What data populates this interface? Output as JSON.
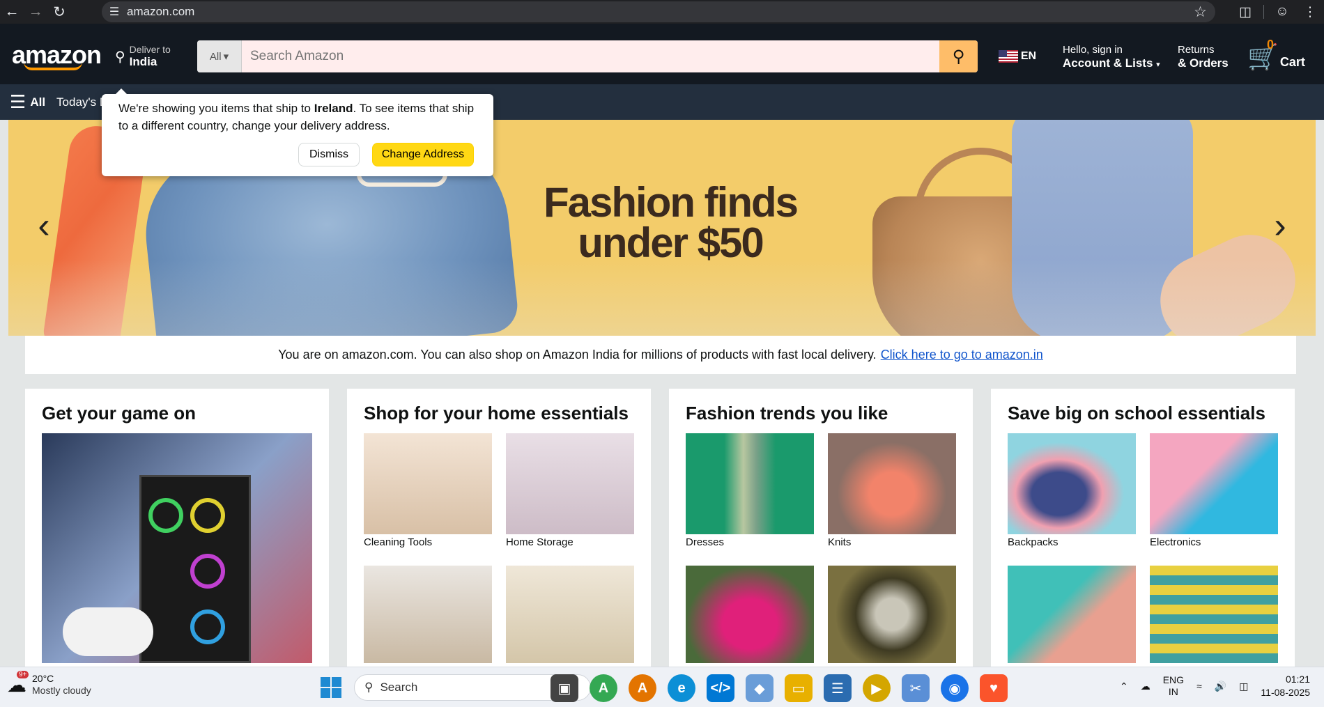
{
  "browser": {
    "url": "amazon.com"
  },
  "header": {
    "logo_text": "amazon",
    "deliver_label": "Deliver to",
    "deliver_country": "India",
    "search_category": "All",
    "search_placeholder": "Search Amazon",
    "lang": "EN",
    "account_greeting": "Hello, sign in",
    "account_label": "Account & Lists",
    "returns_label": "Returns",
    "orders_label": "& Orders",
    "cart_count": "0",
    "cart_label": "Cart"
  },
  "subnav": {
    "all_label": "All",
    "deals_label": "Today's Deals"
  },
  "popover": {
    "message_prefix": "We're showing you items that ship to ",
    "country": "Ireland",
    "message_suffix": ". To see items that ship to a different country, change your delivery address.",
    "dismiss_label": "Dismiss",
    "change_label": "Change Address"
  },
  "hero": {
    "headline_1": "Fashion finds",
    "headline_2": "under $50"
  },
  "info_bar": {
    "text": "You are on amazon.com. You can also shop on Amazon India for millions of products with fast local delivery.",
    "link": "Click here to go to amazon.in"
  },
  "cards": [
    {
      "title": "Get your game on"
    },
    {
      "title": "Shop for your home essentials",
      "tiles": [
        "Cleaning Tools",
        "Home Storage"
      ]
    },
    {
      "title": "Fashion trends you like",
      "tiles": [
        "Dresses",
        "Knits"
      ]
    },
    {
      "title": "Save big on school essentials",
      "tiles": [
        "Backpacks",
        "Electronics"
      ]
    }
  ],
  "taskbar": {
    "weather_temp": "20°C",
    "weather_desc": "Mostly cloudy",
    "weather_badge": "9+",
    "search_label": "Search",
    "lang_1": "ENG",
    "lang_2": "IN",
    "time": "01:21",
    "date": "11-08-2025"
  },
  "colors": {
    "amazon_dark": "#131921",
    "amazon_subnav": "#232f3e",
    "search_button": "#febd69",
    "change_button": "#ffd814",
    "hero_bg": "#f3cc6a"
  }
}
